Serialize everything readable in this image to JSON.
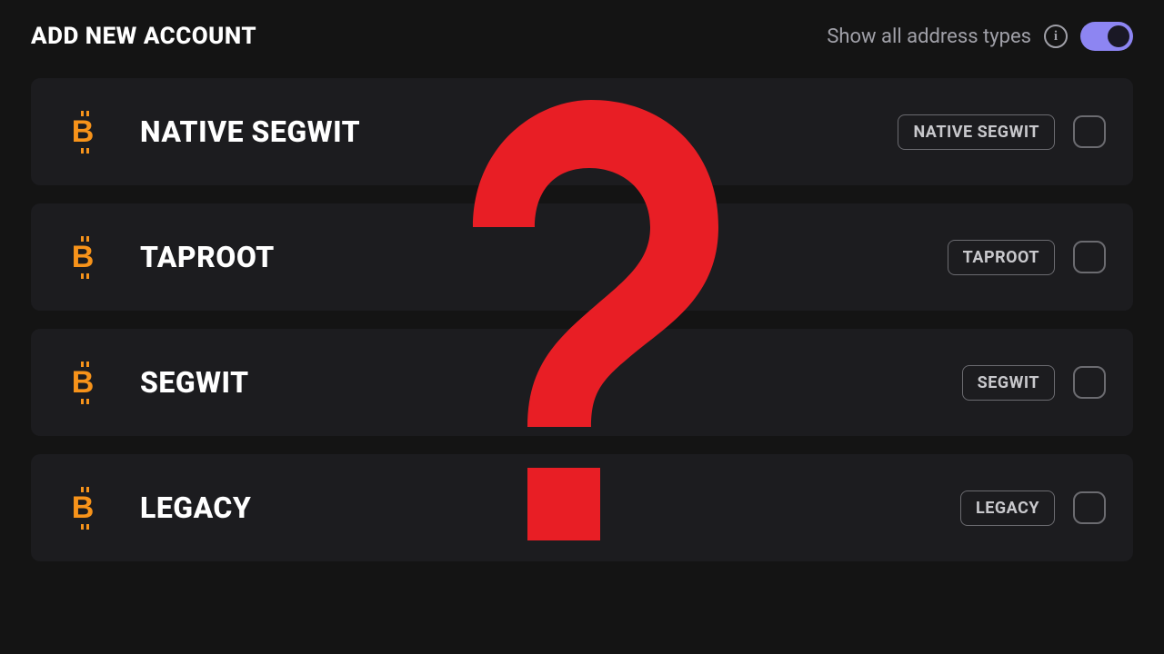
{
  "header": {
    "title": "ADD NEW ACCOUNT",
    "show_all_label": "Show all address types",
    "toggle_on": true
  },
  "accounts": [
    {
      "icon": "bitcoin",
      "label": "NATIVE SEGWIT",
      "badge": "NATIVE SEGWIT",
      "checked": false
    },
    {
      "icon": "bitcoin",
      "label": "TAPROOT",
      "badge": "TAPROOT",
      "checked": false
    },
    {
      "icon": "bitcoin",
      "label": "SEGWIT",
      "badge": "SEGWIT",
      "checked": false
    },
    {
      "icon": "bitcoin",
      "label": "LEGACY",
      "badge": "LEGACY",
      "checked": false
    }
  ],
  "overlay": {
    "symbol": "?",
    "color": "#e81e25"
  }
}
